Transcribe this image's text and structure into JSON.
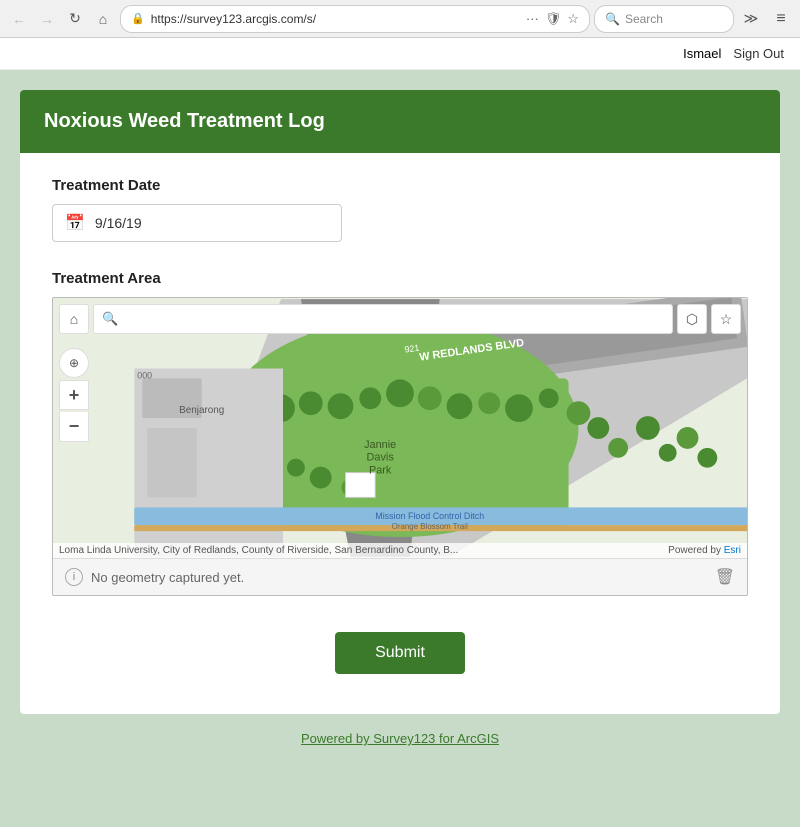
{
  "browser": {
    "url": "https://survey123.arcgis.com/s/",
    "search_placeholder": "Search",
    "back_label": "←",
    "forward_label": "→",
    "refresh_label": "↻",
    "home_label": "⌂",
    "more_label": "···",
    "extend_label": "≫",
    "menu_label": "≡"
  },
  "user_bar": {
    "username": "Ismael",
    "signout_label": "Sign Out"
  },
  "form": {
    "title": "Noxious Weed Treatment Log",
    "treatment_date": {
      "label": "Treatment Date",
      "value": "9/16/19"
    },
    "treatment_area": {
      "label": "Treatment Area",
      "no_geometry_text": "No geometry captured yet.",
      "attribution_text": "Loma Linda University, City of Redlands, County of Riverside, San Bernardino County, B...",
      "powered_by": "Powered by",
      "esri_label": "Esri"
    },
    "submit_label": "Submit"
  },
  "footer": {
    "link_text": "Powered by Survey123 for ArcGIS"
  },
  "map": {
    "road_label": "W REDLANDS BLVD",
    "park_label": "Jannie\nDavis\nPark",
    "building_label": "Benjarong",
    "ditch_label": "Mission Flood Control Ditch",
    "trail_label": "Orange Blossom Trail",
    "road_number": "921"
  }
}
